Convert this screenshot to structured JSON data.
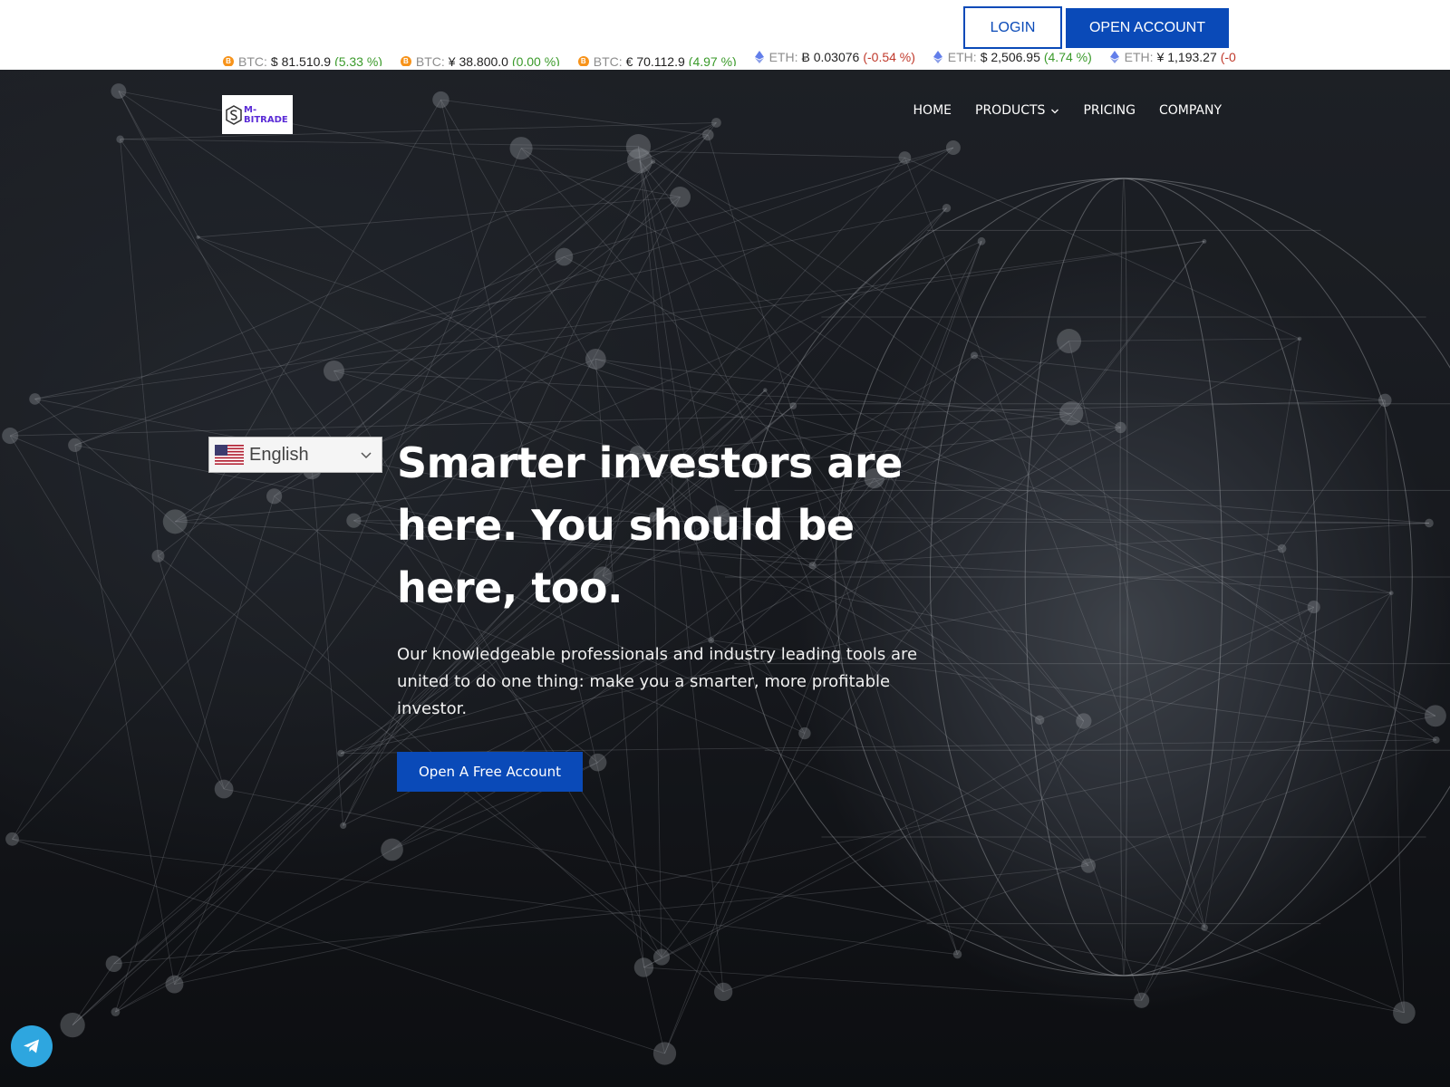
{
  "header": {
    "login_label": "LOGIN",
    "open_account_label": "OPEN ACCOUNT"
  },
  "ticker": [
    {
      "coin": "btc",
      "symbol": "BTC:",
      "value": "$ 81,510.9",
      "change": "(5.33 %)",
      "direction": "up"
    },
    {
      "coin": "btc",
      "symbol": "BTC:",
      "value": "¥ 38,800.0",
      "change": "(0.00 %)",
      "direction": "up"
    },
    {
      "coin": "btc",
      "symbol": "BTC:",
      "value": "€ 70,112.9",
      "change": "(4.97 %)",
      "direction": "up"
    },
    {
      "coin": "eth",
      "symbol": "ETH:",
      "value": "Ƀ 0.03076",
      "change": "(-0.54 %)",
      "direction": "down"
    },
    {
      "coin": "eth",
      "symbol": "ETH:",
      "value": "$ 2,506.95",
      "change": "(4.74 %)",
      "direction": "up"
    },
    {
      "coin": "eth",
      "symbol": "ETH:",
      "value": "¥ 1,193.27",
      "change": "(-0",
      "direction": "down"
    }
  ],
  "nav": {
    "logo_line1": "M-",
    "logo_line2": "BITRADE",
    "links": {
      "home": "HOME",
      "products": "PRODUCTS",
      "pricing": "PRICING",
      "company": "COMPANY"
    }
  },
  "language": {
    "selected": "English"
  },
  "hero": {
    "headline": "Smarter investors are here. You should be here, too.",
    "subtext": "Our knowledgeable professionals and industry leading tools are united to do one thing: make you a smarter, more profitable investor.",
    "cta_label": "Open A Free Account"
  },
  "colors": {
    "brand_blue": "#0a4ab8",
    "positive": "#3a9a2a",
    "negative": "#c0392b",
    "btc_orange": "#f7931a",
    "telegram_blue": "#2ea6df"
  },
  "icons": {
    "btc": "bitcoin-icon",
    "eth": "ethereum-icon",
    "chevron": "chevron-down-icon",
    "flag": "us-flag-icon",
    "telegram": "telegram-icon"
  }
}
